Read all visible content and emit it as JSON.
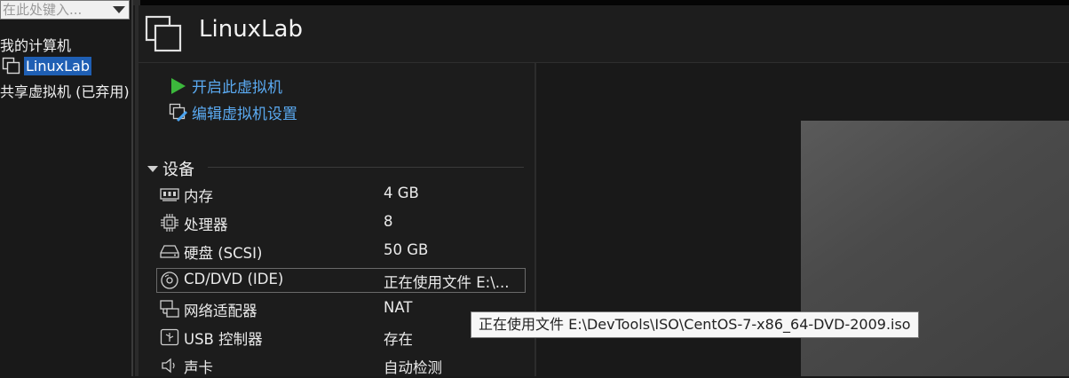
{
  "library": {
    "search_placeholder": "在此处键入...",
    "tree": {
      "my_computer": "我的计算机",
      "vm_name": "LinuxLab",
      "shared_vms": "共享虚拟机 (已弃用)"
    }
  },
  "header": {
    "title": "LinuxLab"
  },
  "commands": {
    "power_on": "开启此虚拟机",
    "edit_settings": "编辑虚拟机设置"
  },
  "devices": {
    "section_title": "设备",
    "items": [
      {
        "name": "内存",
        "value": "4 GB",
        "icon": "memory-icon"
      },
      {
        "name": "处理器",
        "value": "8",
        "icon": "cpu-icon"
      },
      {
        "name": "硬盘 (SCSI)",
        "value": "50 GB",
        "icon": "hard-disk-icon"
      },
      {
        "name": "CD/DVD (IDE)",
        "value": "正在使用文件 E:\\...",
        "icon": "cd-dvd-icon"
      },
      {
        "name": "网络适配器",
        "value": "NAT",
        "icon": "network-adapter-icon"
      },
      {
        "name": "USB 控制器",
        "value": "存在",
        "icon": "usb-icon"
      },
      {
        "name": "声卡",
        "value": "自动检测",
        "icon": "sound-icon"
      }
    ]
  },
  "tooltip": {
    "text": "正在使用文件 E:\\DevTools\\ISO\\CentOS-7-x86_64-DVD-2009.iso"
  },
  "colors": {
    "link": "#5aa9f0",
    "selection": "#1f5fb4",
    "play_green": "#3cb83c"
  }
}
